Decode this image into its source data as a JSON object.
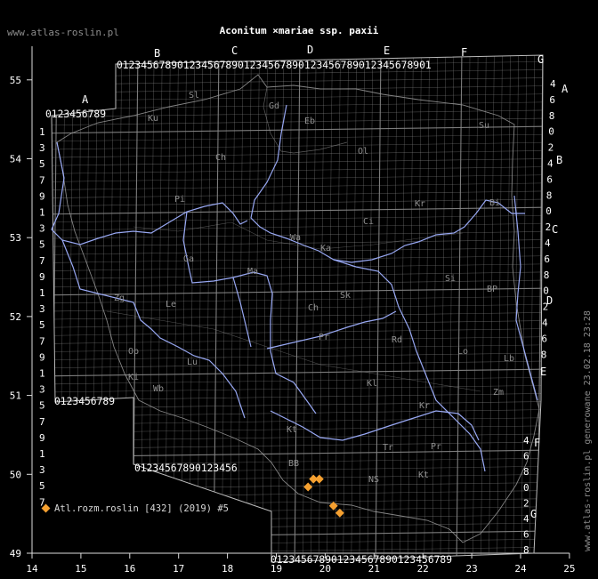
{
  "title": "Aconitum ×mariae ssp. paxii",
  "watermark_top": "www.atlas-roslin.pl",
  "watermark_side": "www.atlas-roslin.pl generowane 23.02.18 23:28",
  "legend": {
    "label": "Atl.rozm.roslin [432] (2019) #5",
    "marker_color": "#f5a030"
  },
  "colors": {
    "background": "#000000",
    "grid": "#8a8a8a",
    "river": "#9fb0ff",
    "border": "#9a9a9a",
    "text": "#ffffff"
  },
  "axes": {
    "x_ticks": [
      "14",
      "15",
      "16",
      "17",
      "18",
      "19",
      "20",
      "21",
      "22",
      "23",
      "24",
      "25"
    ],
    "y_ticks": [
      "55",
      "54",
      "53",
      "52",
      "51",
      "50",
      "49"
    ]
  },
  "grid_columns": {
    "letters": [
      "A",
      "B",
      "C",
      "D",
      "E",
      "F",
      "G"
    ],
    "digits": "0123456789"
  },
  "grid_rows": {
    "letters": [
      "A",
      "B",
      "C",
      "D",
      "E",
      "F",
      "G"
    ]
  },
  "regions": [
    "Sl",
    "Ku",
    "Gd",
    "Eb",
    "Su",
    "Ch",
    "Ol",
    "Pi",
    "Ci",
    "Bi",
    "Wa",
    "Ka",
    "Ma",
    "Kr",
    "Ga",
    "Si",
    "BP",
    "Zg",
    "Le",
    "Lo",
    "Sk",
    "Pr",
    "Rd",
    "Lb",
    "Ch",
    "Lu",
    "Wb",
    "Op",
    "Kt",
    "Kl",
    "Zm",
    "Tr",
    "Pr",
    "BB",
    "NS",
    "Kt",
    "Kr",
    "Ki"
  ],
  "occurrences": [
    {
      "lon": 19.65,
      "lat": 49.84
    },
    {
      "lon": 19.76,
      "lat": 49.94
    },
    {
      "lon": 19.88,
      "lat": 49.94
    },
    {
      "lon": 20.17,
      "lat": 49.6
    },
    {
      "lon": 20.3,
      "lat": 49.51
    }
  ]
}
